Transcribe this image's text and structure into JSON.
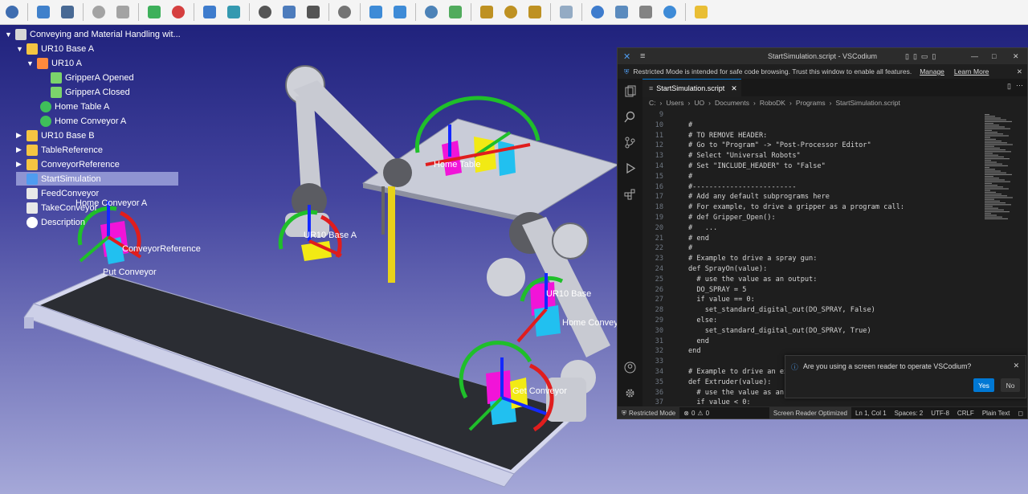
{
  "toolbar": {
    "icons": [
      "new-station-icon",
      "open-icon",
      "save-icon",
      "undo-icon",
      "redo-icon",
      "add-reference-frame-icon",
      "add-target-icon",
      "fit-all-icon",
      "view-cube-icon",
      "select-icon",
      "move-reference-icon",
      "move-object-icon",
      "tool-icon",
      "run-simulation-icon",
      "pause-simulation-icon",
      "python-icon",
      "add-program-icon",
      "add-joint-move-icon",
      "add-linear-move-icon",
      "add-circular-move-icon",
      "pause-instruction-icon",
      "info-icon",
      "settings-list-icon",
      "io-icon",
      "refresh-icon",
      "package-icon"
    ]
  },
  "tree": {
    "items": [
      {
        "label": "Conveying and Material Handling wit...",
        "icon": "station-icon",
        "expanded": true
      },
      {
        "label": "UR10 Base A",
        "icon": "reference-frame-icon",
        "expanded": true
      },
      {
        "label": "UR10 A",
        "icon": "robot-icon",
        "expanded": true
      },
      {
        "label": "GripperA Opened",
        "icon": "gripper-icon"
      },
      {
        "label": "GripperA Closed",
        "icon": "gripper-icon"
      },
      {
        "label": "Home Table A",
        "icon": "target-icon"
      },
      {
        "label": "Home Conveyor A",
        "icon": "target-icon"
      },
      {
        "label": "UR10 Base B",
        "icon": "reference-frame-icon",
        "expanded": false
      },
      {
        "label": "TableReference",
        "icon": "reference-frame-icon",
        "expanded": false
      },
      {
        "label": "ConveyorReference",
        "icon": "reference-frame-icon",
        "expanded": false
      },
      {
        "label": "StartSimulation",
        "icon": "script-icon",
        "selected": true
      },
      {
        "label": "FeedConveyor",
        "icon": "document-icon"
      },
      {
        "label": "TakeConveyor",
        "icon": "document-icon"
      },
      {
        "label": "Description",
        "icon": "description-icon"
      }
    ]
  },
  "scene": {
    "labels": {
      "home_conveyor_a": "Home Conveyor A",
      "conveyor_reference": "ConveyorReference",
      "put_conveyor": "Put Conveyor",
      "ur10_base_a": "UR10 Base A",
      "home_table": "Home Table",
      "ur10_base_b": "UR10 Base",
      "home_conveyor_b": "Home Conveyor",
      "get_conveyor": "Get Conveyor"
    }
  },
  "vscodium": {
    "title": "StartSimulation.script - VSCodium",
    "banner": "Restricted Mode is intended for safe code browsing. Trust this window to enable all features.",
    "banner_manage": "Manage",
    "banner_learn": "Learn More",
    "tab": "StartSimulation.script",
    "breadcrumb": [
      "C:",
      "Users",
      "UO",
      "Documents",
      "RoboDK",
      "Programs",
      "StartSimulation.script"
    ],
    "code": [
      {
        "n": "9",
        "t": ""
      },
      {
        "n": "10",
        "t": "#"
      },
      {
        "n": "11",
        "t": "# TO REMOVE HEADER:"
      },
      {
        "n": "12",
        "t": "# Go to \"Program\" -> \"Post-Processor Editor\""
      },
      {
        "n": "13",
        "t": "# Select \"Universal Robots\""
      },
      {
        "n": "14",
        "t": "# Set \"INCLUDE_HEADER\" to \"False\""
      },
      {
        "n": "15",
        "t": "#"
      },
      {
        "n": "16",
        "t": "#-------------------------"
      },
      {
        "n": "17",
        "t": "# Add any default subprograms here"
      },
      {
        "n": "18",
        "t": "# For example, to drive a gripper as a program call:"
      },
      {
        "n": "19",
        "t": "# def Gripper_Open():"
      },
      {
        "n": "20",
        "t": "#   ..."
      },
      {
        "n": "21",
        "t": "# end"
      },
      {
        "n": "22",
        "t": "#"
      },
      {
        "n": "23",
        "t": "# Example to drive a spray gun:"
      },
      {
        "n": "24",
        "t": "def SprayOn(value):"
      },
      {
        "n": "25",
        "t": "  # use the value as an output:"
      },
      {
        "n": "26",
        "t": "  DO_SPRAY = 5"
      },
      {
        "n": "27",
        "t": "  if value == 0:"
      },
      {
        "n": "28",
        "t": "    set_standard_digital_out(DO_SPRAY, False)"
      },
      {
        "n": "29",
        "t": "  else:"
      },
      {
        "n": "30",
        "t": "    set_standard_digital_out(DO_SPRAY, True)"
      },
      {
        "n": "31",
        "t": "  end"
      },
      {
        "n": "32",
        "t": "end"
      },
      {
        "n": "33",
        "t": ""
      },
      {
        "n": "34",
        "t": "# Example to drive an ex"
      },
      {
        "n": "35",
        "t": "def Extruder(value):"
      },
      {
        "n": "36",
        "t": "  # use the value as an"
      },
      {
        "n": "37",
        "t": "  if value < 0:"
      }
    ],
    "notification": {
      "text": "Are you using a screen reader to operate VSCodium?",
      "yes": "Yes",
      "no": "No"
    },
    "status": {
      "restricted": "Restricted Mode",
      "problems": "0",
      "warnings": "0",
      "screen_reader": "Screen Reader Optimized",
      "position": "Ln 1, Col 1",
      "spaces": "Spaces: 2",
      "encoding": "UTF-8",
      "eol": "CRLF",
      "language": "Plain Text"
    },
    "accent": "#0078d4"
  }
}
